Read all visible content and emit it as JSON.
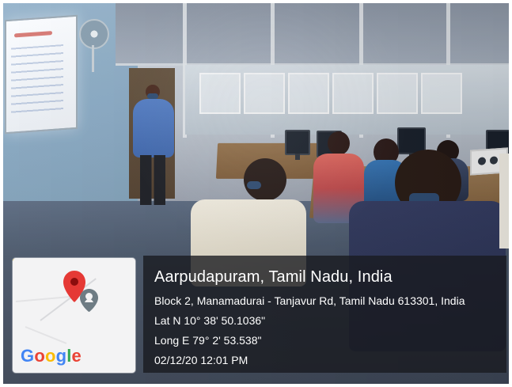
{
  "overlay": {
    "title": "Aarpudapuram, Tamil Nadu, India",
    "address": "Block 2, Manamadurai - Tanjavur Rd, Tamil Nadu 613301, India",
    "latitude": "Lat N 10° 38' 50.1036\"",
    "longitude": "Long E 79° 2' 53.538\"",
    "timestamp": "02/12/20 12:01 PM"
  },
  "map": {
    "logo_letters": [
      "G",
      "o",
      "o",
      "g",
      "l",
      "e"
    ],
    "marker_icon": "map-pin-icon",
    "secondary_icon": "location-avatar-icon"
  },
  "photo": {
    "scene_icon": "classroom-photo"
  }
}
